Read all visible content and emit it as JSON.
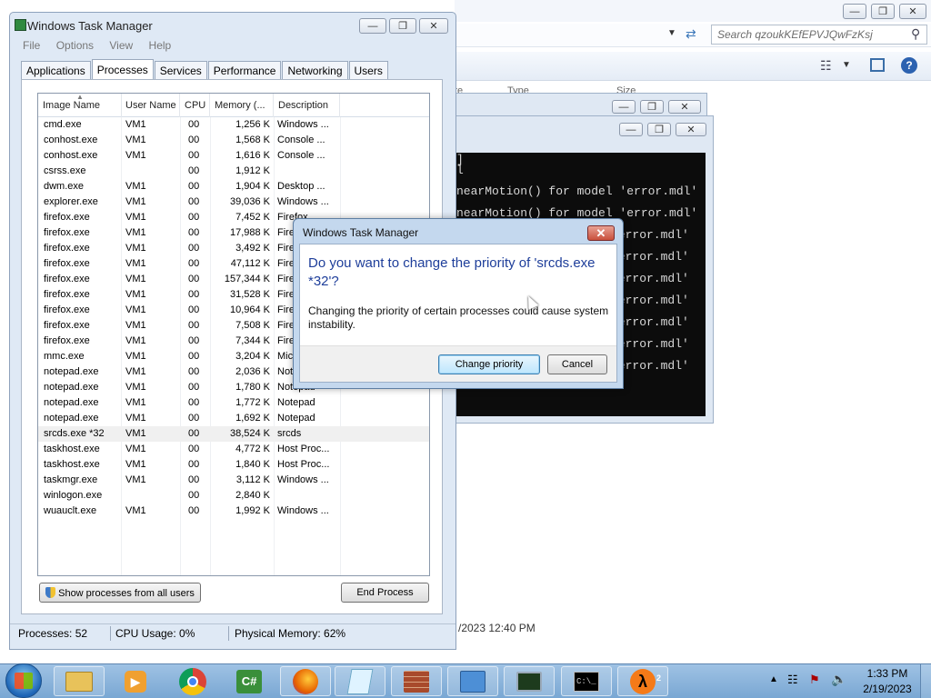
{
  "explorer": {
    "search_placeholder": "Search qzoukKEfEPVJQwFzKsj",
    "column_headers": [
      "te",
      "Type",
      "Size"
    ],
    "status_date": "/2023 12:40 PM"
  },
  "console": {
    "lines": [
      "]",
      "l",
      "nearMotion() for model 'error.mdl'",
      "nearMotion() for model 'error.mdl'",
      "'error.mdl'",
      "'error.mdl'",
      "'error.mdl'",
      "'error.mdl'",
      "'error.mdl'",
      "'error.mdl'",
      "'error.mdl'"
    ]
  },
  "taskmanager": {
    "title": "Windows Task Manager",
    "menu": [
      "File",
      "Options",
      "View",
      "Help"
    ],
    "tabs": [
      "Applications",
      "Processes",
      "Services",
      "Performance",
      "Networking",
      "Users"
    ],
    "active_tab": "Processes",
    "columns": [
      "Image Name",
      "User Name",
      "CPU",
      "Memory (...",
      "Description"
    ],
    "processes": [
      {
        "name": "cmd.exe",
        "user": "VM1",
        "cpu": "00",
        "mem": "1,256 K",
        "desc": "Windows ..."
      },
      {
        "name": "conhost.exe",
        "user": "VM1",
        "cpu": "00",
        "mem": "1,568 K",
        "desc": "Console ..."
      },
      {
        "name": "conhost.exe",
        "user": "VM1",
        "cpu": "00",
        "mem": "1,616 K",
        "desc": "Console ..."
      },
      {
        "name": "csrss.exe",
        "user": "",
        "cpu": "00",
        "mem": "1,912 K",
        "desc": ""
      },
      {
        "name": "dwm.exe",
        "user": "VM1",
        "cpu": "00",
        "mem": "1,904 K",
        "desc": "Desktop ..."
      },
      {
        "name": "explorer.exe",
        "user": "VM1",
        "cpu": "00",
        "mem": "39,036 K",
        "desc": "Windows ..."
      },
      {
        "name": "firefox.exe",
        "user": "VM1",
        "cpu": "00",
        "mem": "7,452 K",
        "desc": "Firefox"
      },
      {
        "name": "firefox.exe",
        "user": "VM1",
        "cpu": "00",
        "mem": "17,988 K",
        "desc": "Firefox"
      },
      {
        "name": "firefox.exe",
        "user": "VM1",
        "cpu": "00",
        "mem": "3,492 K",
        "desc": "Firefox"
      },
      {
        "name": "firefox.exe",
        "user": "VM1",
        "cpu": "00",
        "mem": "47,112 K",
        "desc": "Firefox"
      },
      {
        "name": "firefox.exe",
        "user": "VM1",
        "cpu": "00",
        "mem": "157,344 K",
        "desc": "Firefox"
      },
      {
        "name": "firefox.exe",
        "user": "VM1",
        "cpu": "00",
        "mem": "31,528 K",
        "desc": "Firefox"
      },
      {
        "name": "firefox.exe",
        "user": "VM1",
        "cpu": "00",
        "mem": "10,964 K",
        "desc": "Firefox"
      },
      {
        "name": "firefox.exe",
        "user": "VM1",
        "cpu": "00",
        "mem": "7,508 K",
        "desc": "Firefox"
      },
      {
        "name": "firefox.exe",
        "user": "VM1",
        "cpu": "00",
        "mem": "7,344 K",
        "desc": "Firefox"
      },
      {
        "name": "mmc.exe",
        "user": "VM1",
        "cpu": "00",
        "mem": "3,204 K",
        "desc": "Microsoft"
      },
      {
        "name": "notepad.exe",
        "user": "VM1",
        "cpu": "00",
        "mem": "2,036 K",
        "desc": "Notepad"
      },
      {
        "name": "notepad.exe",
        "user": "VM1",
        "cpu": "00",
        "mem": "1,780 K",
        "desc": "Notepad"
      },
      {
        "name": "notepad.exe",
        "user": "VM1",
        "cpu": "00",
        "mem": "1,772 K",
        "desc": "Notepad"
      },
      {
        "name": "notepad.exe",
        "user": "VM1",
        "cpu": "00",
        "mem": "1,692 K",
        "desc": "Notepad"
      },
      {
        "name": "srcds.exe *32",
        "user": "VM1",
        "cpu": "00",
        "mem": "38,524 K",
        "desc": "srcds"
      },
      {
        "name": "taskhost.exe",
        "user": "VM1",
        "cpu": "00",
        "mem": "4,772 K",
        "desc": "Host Proc..."
      },
      {
        "name": "taskhost.exe",
        "user": "VM1",
        "cpu": "00",
        "mem": "1,840 K",
        "desc": "Host Proc..."
      },
      {
        "name": "taskmgr.exe",
        "user": "VM1",
        "cpu": "00",
        "mem": "3,112 K",
        "desc": "Windows ..."
      },
      {
        "name": "winlogon.exe",
        "user": "",
        "cpu": "00",
        "mem": "2,840 K",
        "desc": ""
      },
      {
        "name": "wuauclt.exe",
        "user": "VM1",
        "cpu": "00",
        "mem": "1,992 K",
        "desc": "Windows ..."
      }
    ],
    "selected_process": "srcds.exe *32",
    "show_all_label": "Show processes from all users",
    "end_process_label": "End Process",
    "status": {
      "processes": "Processes: 52",
      "cpu": "CPU Usage: 0%",
      "memory": "Physical Memory: 62%"
    }
  },
  "dialog": {
    "title": "Windows Task Manager",
    "question": "Do you want to change the priority of 'srcds.exe *32'?",
    "warning": "Changing the priority of certain processes could cause system instability.",
    "confirm_label": "Change priority",
    "cancel_label": "Cancel"
  },
  "taskbar": {
    "time": "1:33 PM",
    "date": "2/19/2023",
    "apps": [
      "windows-explorer",
      "media-player",
      "chrome",
      "csharp-editor",
      "firefox",
      "notepad",
      "firewall",
      "control-panel",
      "task-manager",
      "command-prompt",
      "half-life-2"
    ],
    "hl2_badge": "2"
  }
}
